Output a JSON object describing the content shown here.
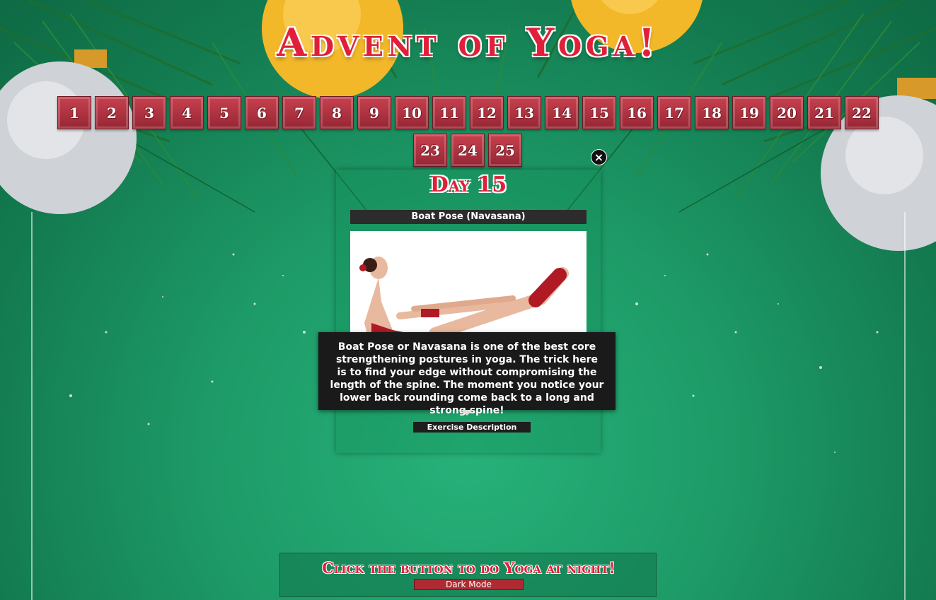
{
  "title": "Advent of Yoga!",
  "days": [
    "1",
    "2",
    "3",
    "4",
    "5",
    "6",
    "7",
    "8",
    "9",
    "10",
    "11",
    "12",
    "13",
    "14",
    "15",
    "16",
    "17",
    "18",
    "19",
    "20",
    "21",
    "22",
    "23",
    "24",
    "25"
  ],
  "modal": {
    "close_label": "×",
    "day_heading": "Day 15",
    "exercise_name": "Boat Pose (Navasana)",
    "tooltip_text": "Boat Pose or Navasana is one of the best core strengthening postures in yoga. The trick here is to find your edge without compromising the length of the spine. The moment you notice your lower back rounding come back to a long and strong spine!",
    "description_button": "Exercise Description"
  },
  "footer": {
    "prompt": "Click the button to do Yoga at night!",
    "dark_mode_button": "Dark Mode"
  },
  "colors": {
    "background": "#1d9a67",
    "accent_red": "#e0203a",
    "day_button": "#b13543"
  }
}
